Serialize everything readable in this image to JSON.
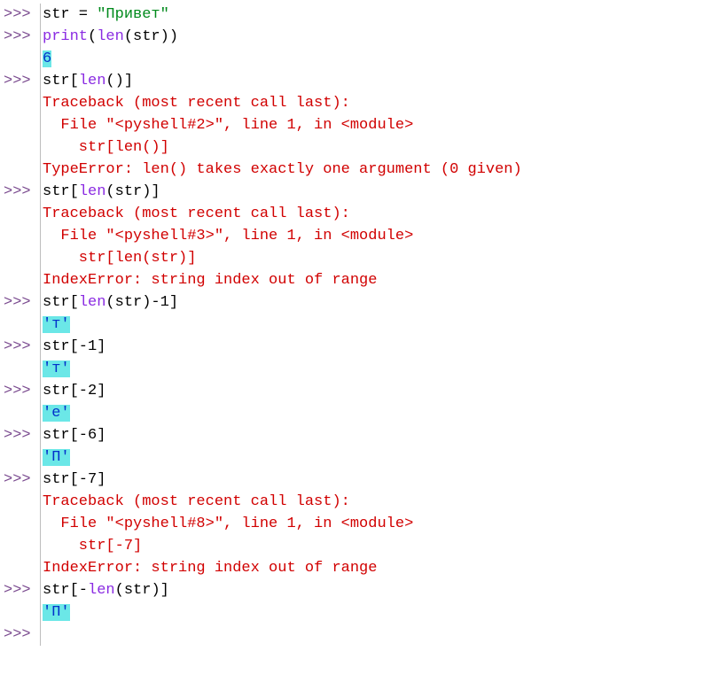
{
  "prompt": ">>>",
  "blank_gutter": "   ",
  "lines": [
    {
      "gutter": "prompt",
      "spans": [
        {
          "cls": "t-id",
          "txt": "str"
        },
        {
          "cls": "t-op",
          "txt": " = "
        },
        {
          "cls": "t-str",
          "txt": "\"Привет\""
        }
      ]
    },
    {
      "gutter": "prompt",
      "spans": [
        {
          "cls": "t-fn",
          "txt": "print"
        },
        {
          "cls": "t-op",
          "txt": "("
        },
        {
          "cls": "t-fn",
          "txt": "len"
        },
        {
          "cls": "t-op",
          "txt": "("
        },
        {
          "cls": "t-id",
          "txt": "str"
        },
        {
          "cls": "t-op",
          "txt": "))"
        }
      ]
    },
    {
      "gutter": "blank",
      "spans": [
        {
          "cls": "t-out",
          "txt": "6"
        }
      ]
    },
    {
      "gutter": "prompt",
      "spans": [
        {
          "cls": "t-id",
          "txt": "str"
        },
        {
          "cls": "t-op",
          "txt": "["
        },
        {
          "cls": "t-fn",
          "txt": "len"
        },
        {
          "cls": "t-op",
          "txt": "()]"
        }
      ]
    },
    {
      "gutter": "blank",
      "spans": [
        {
          "cls": "t-err",
          "txt": "Traceback (most recent call last):"
        }
      ]
    },
    {
      "gutter": "blank",
      "spans": [
        {
          "cls": "t-err",
          "txt": "  File \"<pyshell#2>\", line 1, in <module>"
        }
      ]
    },
    {
      "gutter": "blank",
      "spans": [
        {
          "cls": "t-err",
          "txt": "    str[len()]"
        }
      ]
    },
    {
      "gutter": "blank",
      "spans": [
        {
          "cls": "t-err",
          "txt": "TypeError: len() takes exactly one argument (0 given)"
        }
      ]
    },
    {
      "gutter": "prompt",
      "spans": [
        {
          "cls": "t-id",
          "txt": "str"
        },
        {
          "cls": "t-op",
          "txt": "["
        },
        {
          "cls": "t-fn",
          "txt": "len"
        },
        {
          "cls": "t-op",
          "txt": "("
        },
        {
          "cls": "t-id",
          "txt": "str"
        },
        {
          "cls": "t-op",
          "txt": ")]"
        }
      ]
    },
    {
      "gutter": "blank",
      "spans": [
        {
          "cls": "t-err",
          "txt": "Traceback (most recent call last):"
        }
      ]
    },
    {
      "gutter": "blank",
      "spans": [
        {
          "cls": "t-err",
          "txt": "  File \"<pyshell#3>\", line 1, in <module>"
        }
      ]
    },
    {
      "gutter": "blank",
      "spans": [
        {
          "cls": "t-err",
          "txt": "    str[len(str)]"
        }
      ]
    },
    {
      "gutter": "blank",
      "spans": [
        {
          "cls": "t-err",
          "txt": "IndexError: string index out of range"
        }
      ]
    },
    {
      "gutter": "prompt",
      "spans": [
        {
          "cls": "t-id",
          "txt": "str"
        },
        {
          "cls": "t-op",
          "txt": "["
        },
        {
          "cls": "t-fn",
          "txt": "len"
        },
        {
          "cls": "t-op",
          "txt": "("
        },
        {
          "cls": "t-id",
          "txt": "str"
        },
        {
          "cls": "t-op",
          "txt": ")-1]"
        }
      ]
    },
    {
      "gutter": "blank",
      "spans": [
        {
          "cls": "t-out",
          "txt": "'т'"
        }
      ]
    },
    {
      "gutter": "prompt",
      "spans": [
        {
          "cls": "t-id",
          "txt": "str"
        },
        {
          "cls": "t-op",
          "txt": "[-1]"
        }
      ]
    },
    {
      "gutter": "blank",
      "spans": [
        {
          "cls": "t-out",
          "txt": "'т'"
        }
      ]
    },
    {
      "gutter": "prompt",
      "spans": [
        {
          "cls": "t-id",
          "txt": "str"
        },
        {
          "cls": "t-op",
          "txt": "[-2]"
        }
      ]
    },
    {
      "gutter": "blank",
      "spans": [
        {
          "cls": "t-out",
          "txt": "'е'"
        }
      ]
    },
    {
      "gutter": "prompt",
      "spans": [
        {
          "cls": "t-id",
          "txt": "str"
        },
        {
          "cls": "t-op",
          "txt": "[-6]"
        }
      ]
    },
    {
      "gutter": "blank",
      "spans": [
        {
          "cls": "t-out",
          "txt": "'П'"
        }
      ]
    },
    {
      "gutter": "prompt",
      "spans": [
        {
          "cls": "t-id",
          "txt": "str"
        },
        {
          "cls": "t-op",
          "txt": "[-7]"
        }
      ]
    },
    {
      "gutter": "blank",
      "spans": [
        {
          "cls": "t-err",
          "txt": "Traceback (most recent call last):"
        }
      ]
    },
    {
      "gutter": "blank",
      "spans": [
        {
          "cls": "t-err",
          "txt": "  File \"<pyshell#8>\", line 1, in <module>"
        }
      ]
    },
    {
      "gutter": "blank",
      "spans": [
        {
          "cls": "t-err",
          "txt": "    str[-7]"
        }
      ]
    },
    {
      "gutter": "blank",
      "spans": [
        {
          "cls": "t-err",
          "txt": "IndexError: string index out of range"
        }
      ]
    },
    {
      "gutter": "prompt",
      "spans": [
        {
          "cls": "t-id",
          "txt": "str"
        },
        {
          "cls": "t-op",
          "txt": "[-"
        },
        {
          "cls": "t-fn",
          "txt": "len"
        },
        {
          "cls": "t-op",
          "txt": "("
        },
        {
          "cls": "t-id",
          "txt": "str"
        },
        {
          "cls": "t-op",
          "txt": ")]"
        }
      ]
    },
    {
      "gutter": "blank",
      "spans": [
        {
          "cls": "t-out",
          "txt": "'П'"
        }
      ]
    },
    {
      "gutter": "prompt",
      "spans": []
    }
  ]
}
